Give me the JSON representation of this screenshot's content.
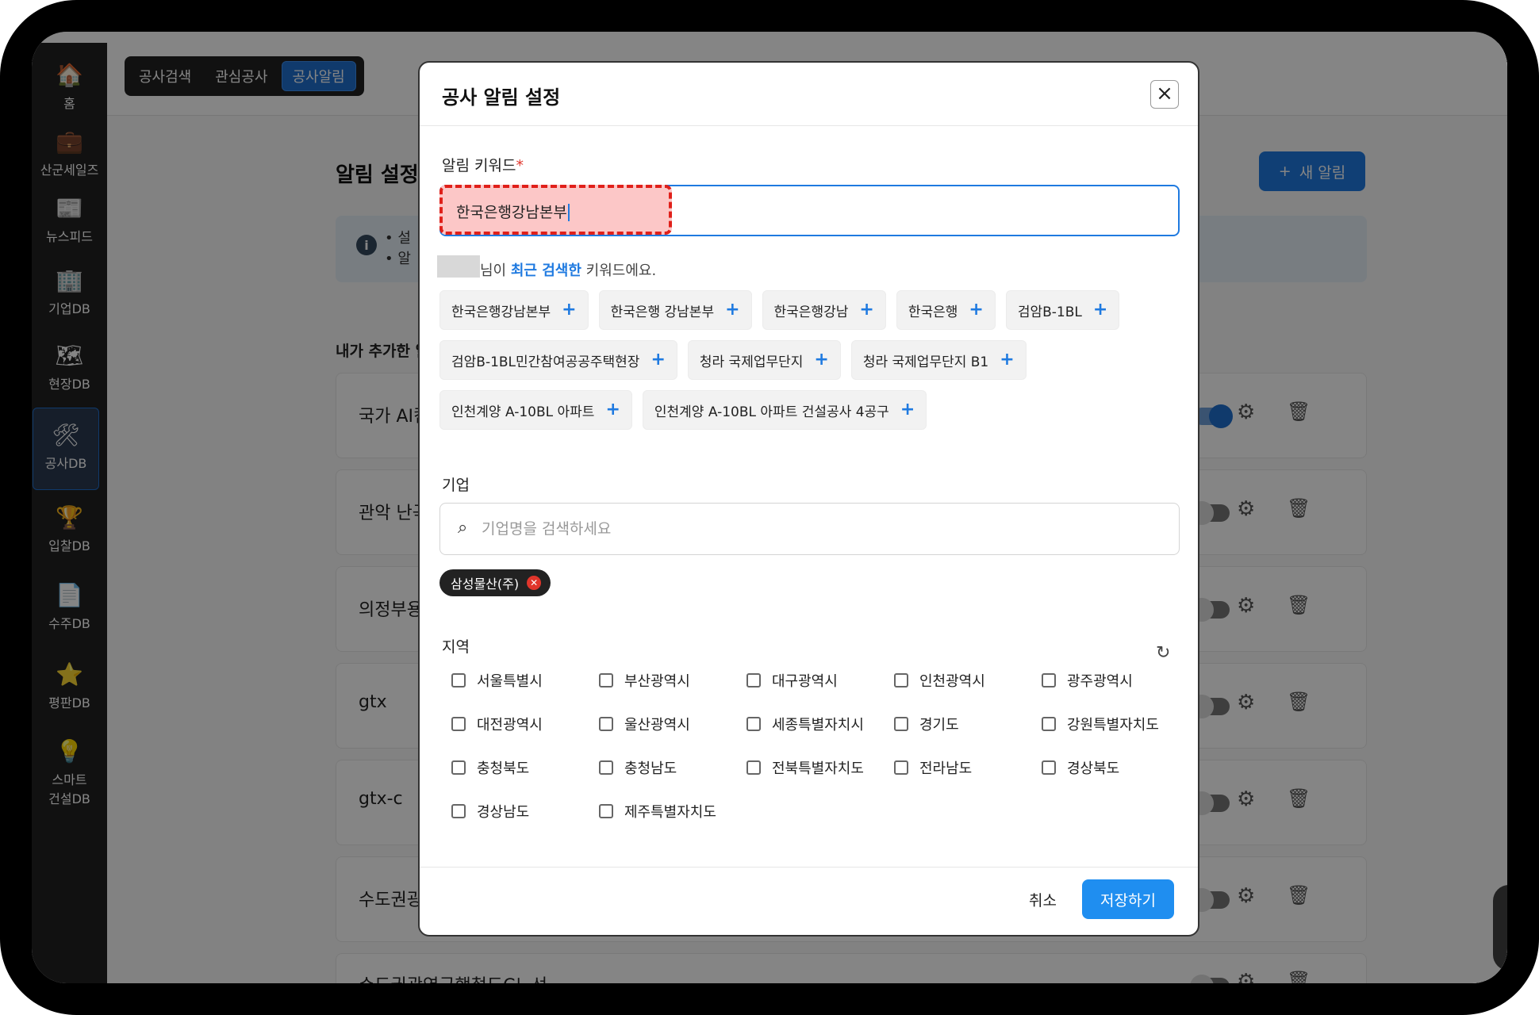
{
  "sidebar": {
    "items": [
      {
        "label": "홈",
        "icon": "home-icon",
        "glyph": "🏠"
      },
      {
        "label": "산군세일즈",
        "icon": "briefcase-icon",
        "glyph": "💼"
      },
      {
        "label": "뉴스피드",
        "icon": "newsreader-icon",
        "glyph": "📰"
      },
      {
        "label": "기업DB",
        "icon": "building-icon",
        "glyph": "🏢"
      },
      {
        "label": "현장DB",
        "icon": "map-pin-icon",
        "glyph": "🗺"
      },
      {
        "label": "공사DB",
        "icon": "tools-icon",
        "glyph": "🛠"
      },
      {
        "label": "입찰DB",
        "icon": "trophy-icon",
        "glyph": "🏆"
      },
      {
        "label": "수주DB",
        "icon": "document-icon",
        "glyph": "📄"
      },
      {
        "label": "평판DB",
        "icon": "star-icon",
        "glyph": "⭐"
      },
      {
        "label": "스마트\n건설DB",
        "icon": "lightbulb-icon",
        "glyph": "💡"
      }
    ]
  },
  "tabs": [
    "공사검색",
    "관심공사",
    "공사알림"
  ],
  "page": {
    "title": "알림 설정",
    "new_button": "새 알림",
    "info_lines": [
      "• 설",
      "• 알"
    ],
    "list_header": "내가 추가한 알",
    "rows": [
      {
        "name": "국가 AI컴",
        "enabled": true
      },
      {
        "name": "관악 난곡",
        "enabled": false
      },
      {
        "name": "의정부용",
        "enabled": false
      },
      {
        "name": "gtx",
        "enabled": false
      },
      {
        "name": "gtx-c",
        "enabled": false
      },
      {
        "name": "수도권광",
        "enabled": false
      },
      {
        "name": "수도권광역급행철도C노선",
        "enabled": false
      }
    ]
  },
  "modal": {
    "title": "공사 알림 설정",
    "keyword_label": "알림 키워드",
    "required_mark": "*",
    "keyword_value": "한국은행강남본부",
    "recent_prefix": "님이 ",
    "recent_bold": "최근 검색한",
    "recent_suffix": " 키워드에요.",
    "recent_keywords": [
      "한국은행강남본부",
      "한국은행 강남본부",
      "한국은행강남",
      "한국은행",
      "검암B-1BL",
      "검암B-1BL민간참여공공주택현장",
      "청라 국제업무단지",
      "청라 국제업무단지 B1",
      "인천계양 A-10BL 아파트",
      "인천계양 A-10BL 아파트 건설공사 4공구"
    ],
    "company_label": "기업",
    "company_placeholder": "기업명을 검색하세요",
    "selected_company": "삼성물산(주)",
    "region_label": "지역",
    "regions": [
      "서울특별시",
      "부산광역시",
      "대구광역시",
      "인천광역시",
      "광주광역시",
      "대전광역시",
      "울산광역시",
      "세종특별자치시",
      "경기도",
      "강원특별자치도",
      "충청북도",
      "충청남도",
      "전북특별자치도",
      "전라남도",
      "경상북도",
      "경상남도",
      "제주특별자치도"
    ],
    "cancel_label": "취소",
    "save_label": "저장하기"
  },
  "colors": {
    "accent": "#1f7ae0",
    "highlight_fill": "#fcc7c7",
    "highlight_border": "#e0201a",
    "sidebar_bg": "#222222"
  }
}
